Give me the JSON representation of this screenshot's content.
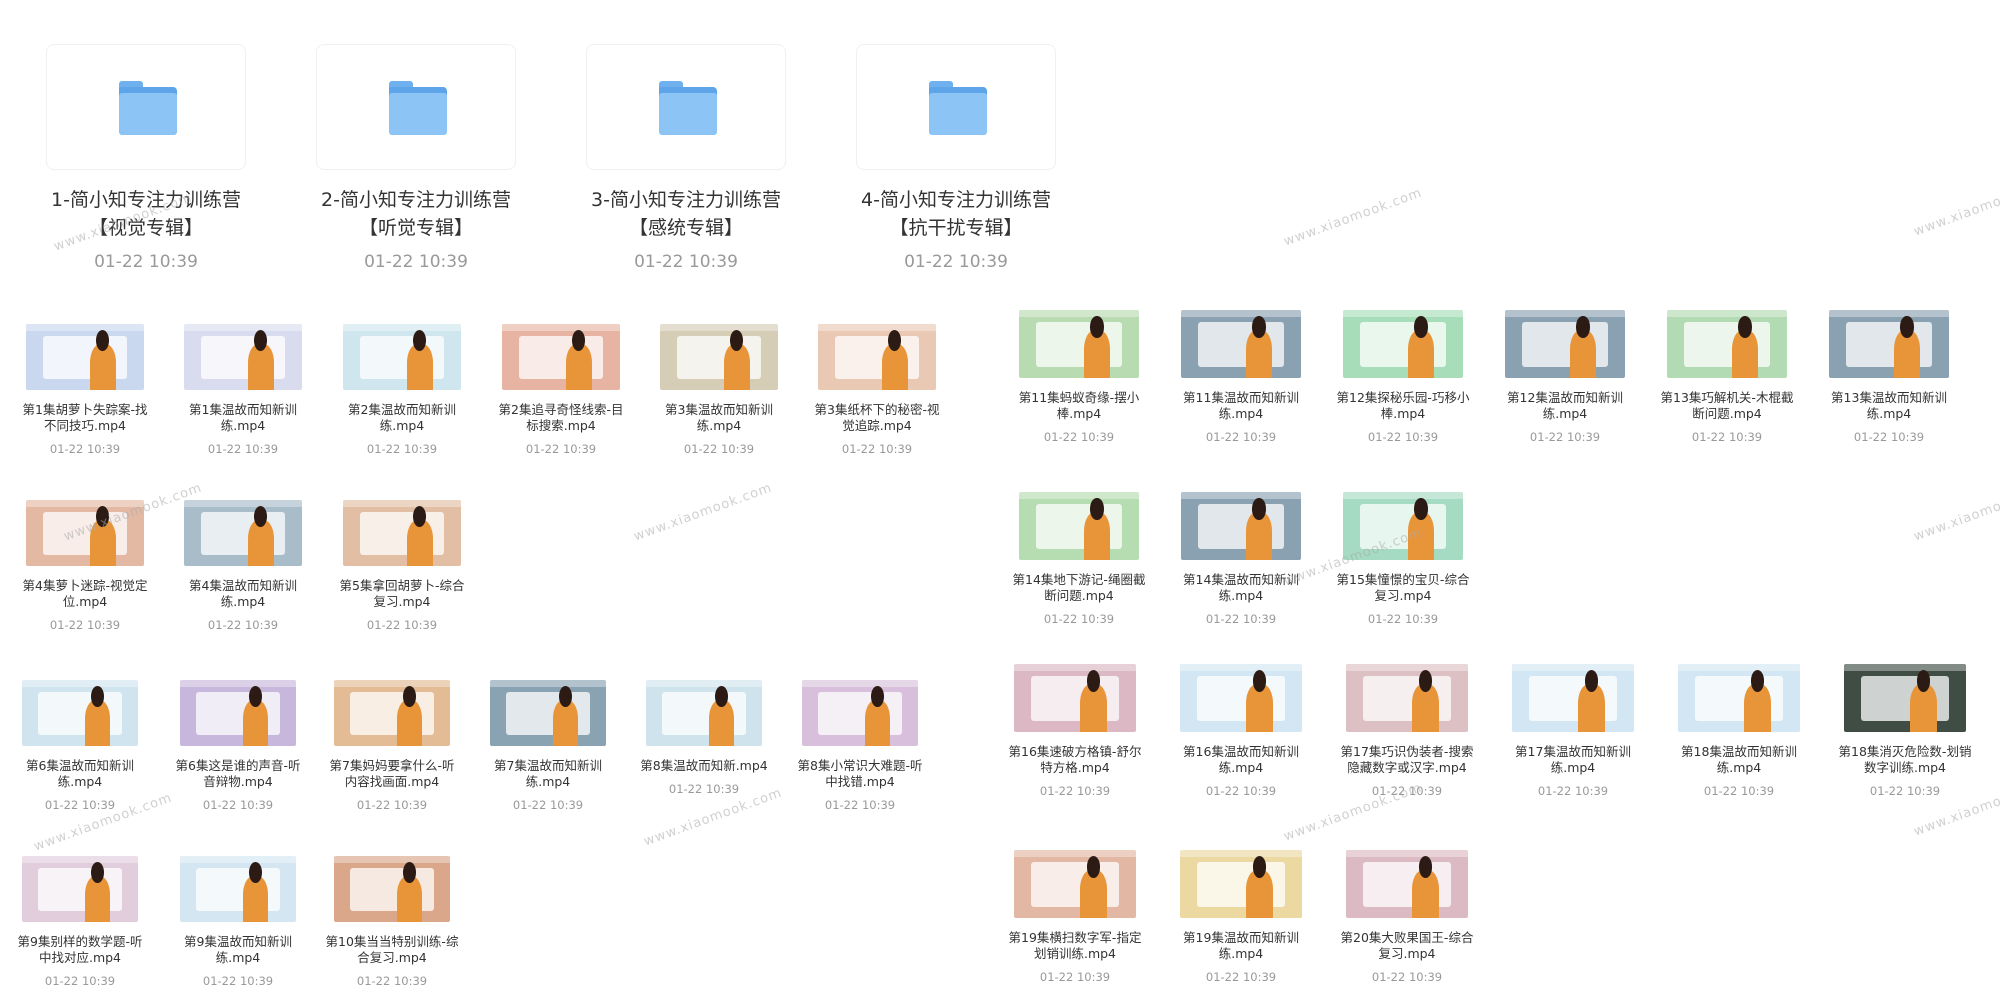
{
  "folders": [
    {
      "title": "1-简小知专注力训练营\n【视觉专辑】",
      "date": "01-22 10:39"
    },
    {
      "title": "2-简小知专注力训练营\n【听觉专辑】",
      "date": "01-22 10:39"
    },
    {
      "title": "3-简小知专注力训练营\n【感统专辑】",
      "date": "01-22 10:39"
    },
    {
      "title": "4-简小知专注力训练营\n【抗干扰专辑】",
      "date": "01-22 10:39"
    }
  ],
  "files": [
    {
      "name": "第1集胡萝卜失踪案-找不同技巧.mp4",
      "date": "01-22 10:39",
      "thumb_color": "#c9d8ee"
    },
    {
      "name": "第1集温故而知新训练.mp4",
      "date": "01-22 10:39",
      "thumb_color": "#d9dcee"
    },
    {
      "name": "第2集温故而知新训练.mp4",
      "date": "01-22 10:39",
      "thumb_color": "#cfe6ef"
    },
    {
      "name": "第2集追寻奇怪线索-目标搜索.mp4",
      "date": "01-22 10:39",
      "thumb_color": "#e7b4a4"
    },
    {
      "name": "第3集温故而知新训练.mp4",
      "date": "01-22 10:39",
      "thumb_color": "#d6cdb7"
    },
    {
      "name": "第3集纸杯下的秘密-视觉追踪.mp4",
      "date": "01-22 10:39",
      "thumb_color": "#e9c8b4"
    },
    {
      "name": "第4集萝卜迷踪-视觉定位.mp4",
      "date": "01-22 10:39",
      "thumb_color": "#e3b9a4"
    },
    {
      "name": "第4集温故而知新训练.mp4",
      "date": "01-22 10:39",
      "thumb_color": "#a9bcc9"
    },
    {
      "name": "第5集拿回胡萝卜-综合复习.mp4",
      "date": "01-22 10:39",
      "thumb_color": "#e2bfa4"
    },
    {
      "name": "第6集温故而知新训练.mp4",
      "date": "01-22 10:39",
      "thumb_color": "#cfe4ef"
    },
    {
      "name": "第6集这是谁的声音-听音辩物.mp4",
      "date": "01-22 10:39",
      "thumb_color": "#c7b7dc"
    },
    {
      "name": "第7集妈妈要拿什么-听内容找画面.mp4",
      "date": "01-22 10:39",
      "thumb_color": "#e3bb95"
    },
    {
      "name": "第7集温故而知新训练.mp4",
      "date": "01-22 10:39",
      "thumb_color": "#8aa3b3"
    },
    {
      "name": "第8集温故而知新.mp4",
      "date": "01-22 10:39",
      "thumb_color": "#cfe3ec"
    },
    {
      "name": "第8集小常识大难题-听中找错.mp4",
      "date": "01-22 10:39",
      "thumb_color": "#d8c0dc"
    },
    {
      "name": "第9集别样的数学题-听中找对应.mp4",
      "date": "01-22 10:39",
      "thumb_color": "#e2cddd"
    },
    {
      "name": "第9集温故而知新训练.mp4",
      "date": "01-22 10:39",
      "thumb_color": "#d4e6f2"
    },
    {
      "name": "第10集当当特别训练-综合复习.mp4",
      "date": "01-22 10:39",
      "thumb_color": "#dba78a"
    },
    {
      "name": "第11集蚂蚁奇缘-摆小棒.mp4",
      "date": "01-22 10:39",
      "thumb_color": "#b9dbb1"
    },
    {
      "name": "第11集温故而知新训练.mp4",
      "date": "01-22 10:39",
      "thumb_color": "#8aa1b1"
    },
    {
      "name": "第12集探秘乐园-巧移小棒.mp4",
      "date": "01-22 10:39",
      "thumb_color": "#a7ddb8"
    },
    {
      "name": "第12集温故而知新训练.mp4",
      "date": "01-22 10:39",
      "thumb_color": "#8aa1b1"
    },
    {
      "name": "第13集巧解机关-木棍截断问题.mp4",
      "date": "01-22 10:39",
      "thumb_color": "#b3dbb3"
    },
    {
      "name": "第13集温故而知新训练.mp4",
      "date": "01-22 10:39",
      "thumb_color": "#8aa1b1"
    },
    {
      "name": "第14集地下游记-绳圈截断问题.mp4",
      "date": "01-22 10:39",
      "thumb_color": "#b6dcb1"
    },
    {
      "name": "第14集温故而知新训练.mp4",
      "date": "01-22 10:39",
      "thumb_color": "#8aa1b1"
    },
    {
      "name": "第15集憧憬的宝贝-综合复习.mp4",
      "date": "01-22 10:39",
      "thumb_color": "#a5dbc2"
    },
    {
      "name": "第16集速破方格镇-舒尔特方格.mp4",
      "date": "01-22 10:39",
      "thumb_color": "#dcb7c4"
    },
    {
      "name": "第16集温故而知新训练.mp4",
      "date": "01-22 10:39",
      "thumb_color": "#d3e6f3"
    },
    {
      "name": "第17集巧识伪装者-搜索隐藏数字或汉字.mp4",
      "date": "01-22 10:39",
      "thumb_color": "#dcc0c4"
    },
    {
      "name": "第17集温故而知新训练.mp4",
      "date": "01-22 10:39",
      "thumb_color": "#d3e6f3"
    },
    {
      "name": "第18集温故而知新训练.mp4",
      "date": "01-22 10:39",
      "thumb_color": "#d3e6f3"
    },
    {
      "name": "第18集消灭危险数-划销数字训练.mp4",
      "date": "01-22 10:39",
      "thumb_color": "#3f4d44"
    },
    {
      "name": "第19集横扫数字军-指定划销训练.mp4",
      "date": "01-22 10:39",
      "thumb_color": "#e2b8a4"
    },
    {
      "name": "第19集温故而知新训练.mp4",
      "date": "01-22 10:39",
      "thumb_color": "#ecd9a2"
    },
    {
      "name": "第20集大败果国王-综合复习.mp4",
      "date": "01-22 10:39",
      "thumb_color": "#dcbac4"
    }
  ],
  "watermark_text": "www.xiaomook.com"
}
